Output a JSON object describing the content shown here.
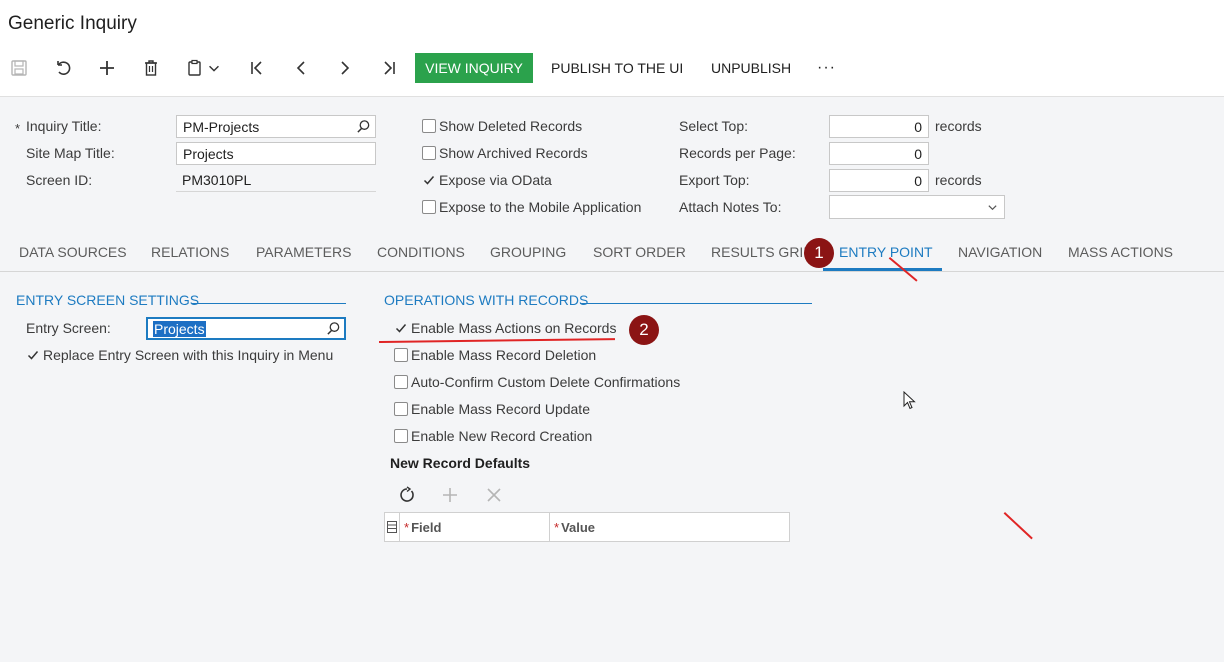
{
  "title": "Generic Inquiry",
  "toolbar": {
    "save": "save-icon",
    "undo": "undo-icon",
    "add": "add-icon",
    "delete": "delete-icon",
    "copy": "clipboard-icon",
    "first": "first-icon",
    "prev": "prev-icon",
    "next": "next-icon",
    "last": "last-icon",
    "view_inquiry": "VIEW INQUIRY",
    "publish": "PUBLISH TO THE UI",
    "unpublish": "UNPUBLISH",
    "more": "···"
  },
  "summary": {
    "inquiry_title_label": "Inquiry Title:",
    "inquiry_title_value": "PM-Projects",
    "sitemap_title_label": "Site Map Title:",
    "sitemap_title_value": "Projects",
    "screen_id_label": "Screen ID:",
    "screen_id_value": "PM3010PL",
    "show_deleted": "Show Deleted Records",
    "show_archived": "Show Archived Records",
    "expose_odata": "Expose via OData",
    "expose_mobile": "Expose to the Mobile Application",
    "select_top_label": "Select Top:",
    "select_top_value": "0",
    "records_unit": "records",
    "records_per_page_label": "Records per Page:",
    "records_per_page_value": "0",
    "export_top_label": "Export Top:",
    "export_top_value": "0",
    "attach_notes_label": "Attach Notes To:",
    "attach_notes_value": ""
  },
  "tabs": [
    "DATA SOURCES",
    "RELATIONS",
    "PARAMETERS",
    "CONDITIONS",
    "GROUPING",
    "SORT ORDER",
    "RESULTS GRID",
    "ENTRY POINT",
    "NAVIGATION",
    "MASS ACTIONS"
  ],
  "active_tab": "ENTRY POINT",
  "entry_settings": {
    "title": "ENTRY SCREEN SETTINGS",
    "entry_screen_label": "Entry Screen:",
    "entry_screen_value": "Projects",
    "replace_entry": "Replace Entry Screen with this Inquiry in Menu"
  },
  "operations": {
    "title": "OPERATIONS WITH RECORDS",
    "enable_mass_actions": "Enable Mass Actions on Records",
    "enable_mass_deletion": "Enable Mass Record Deletion",
    "auto_confirm": "Auto-Confirm Custom Delete Confirmations",
    "enable_mass_update": "Enable Mass Record Update",
    "enable_new_record": "Enable New Record Creation",
    "defaults_title": "New Record Defaults",
    "col_field": "Field",
    "col_value": "Value"
  },
  "markers": [
    "1",
    "2"
  ],
  "colors": {
    "primary": "#2ba24c",
    "accent": "#1d7bc1",
    "marker": "#8b1414",
    "annotation": "#e02525"
  }
}
